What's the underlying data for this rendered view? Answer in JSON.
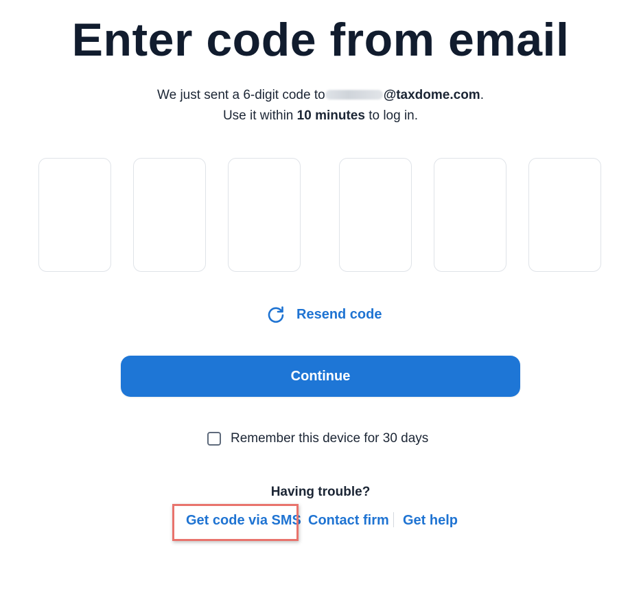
{
  "header": {
    "title": "Enter code from email"
  },
  "message": {
    "line1_prefix": "We just sent a 6-digit code to",
    "email_domain": "@taxdome.com",
    "line1_suffix": ".",
    "line2_prefix": "Use it within",
    "line2_bold": "10 minutes",
    "line2_suffix": "to log in."
  },
  "code_inputs": [
    "",
    "",
    "",
    "",
    "",
    ""
  ],
  "resend": {
    "icon": "refresh-icon",
    "label": "Resend code"
  },
  "continue_button": {
    "label": "Continue"
  },
  "remember_device": {
    "label": "Remember this device for 30 days",
    "checked": false
  },
  "help": {
    "heading": "Having trouble?",
    "links": [
      {
        "label": "Get code via SMS"
      },
      {
        "label": "Contact firm"
      },
      {
        "label": "Get help"
      }
    ]
  },
  "colors": {
    "accent": "#1e76d6",
    "link": "#1e73d2",
    "title": "#111c2e",
    "highlight": "#e8736c"
  }
}
